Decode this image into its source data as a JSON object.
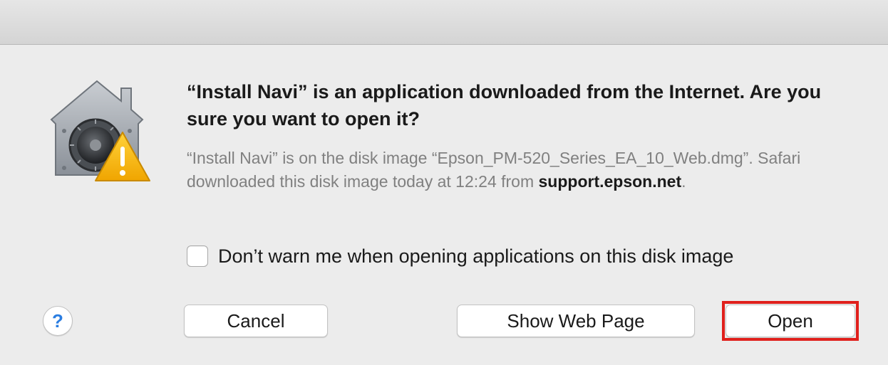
{
  "dialog": {
    "heading": "“Install Navi” is an application downloaded from the Internet. Are you sure you want to open it?",
    "info_prefix": "“Install Navi” is on the disk image “Epson_PM-520_Series_EA_10_Web.dmg”. Safari downloaded this disk image today at 12:24 from ",
    "info_domain": "support.epson.net",
    "info_suffix": ".",
    "checkbox_label": "Don’t warn me when opening applications on this disk image",
    "checkbox_checked": false,
    "icon": "gatekeeper-warning-icon"
  },
  "buttons": {
    "help_label": "?",
    "cancel_label": "Cancel",
    "show_web_page_label": "Show Web Page",
    "open_label": "Open"
  },
  "colors": {
    "highlight": "#e0201c",
    "help": "#2a7de1",
    "warning": "#f5b800"
  }
}
